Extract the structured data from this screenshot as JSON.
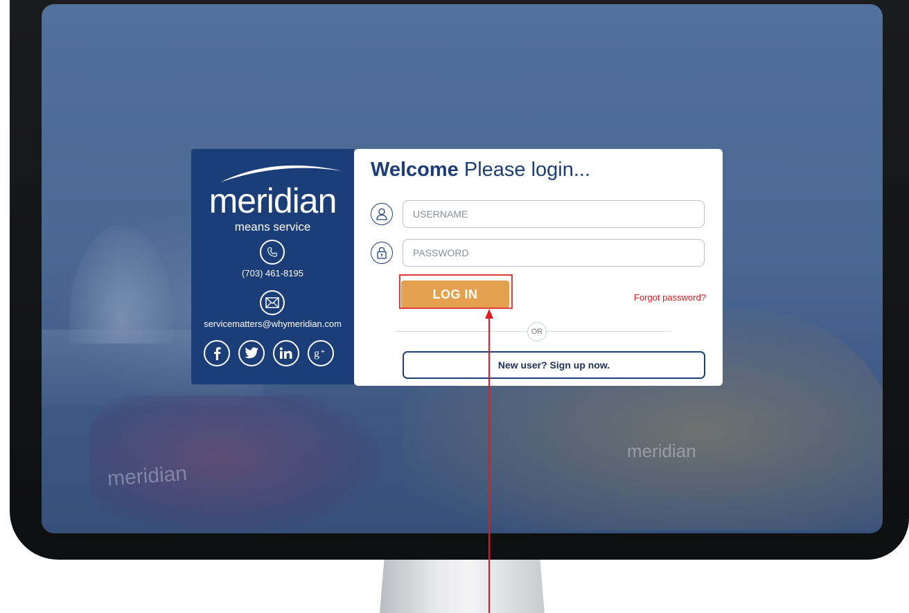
{
  "brand": {
    "name": "meridian",
    "tagline": "means service"
  },
  "contact": {
    "phone": "(703) 461-8195",
    "email": "servicematters@whymeridian.com"
  },
  "social": {
    "items": [
      "facebook-icon",
      "twitter-icon",
      "linkedin-icon",
      "google-plus-icon"
    ]
  },
  "login": {
    "welcome_bold": "Welcome",
    "welcome_rest": " Please login...",
    "username_placeholder": "USERNAME",
    "password_placeholder": "PASSWORD",
    "login_label": "LOG IN",
    "forgot_label": "Forgot password?",
    "or_label": "OR",
    "signup_label": "New user? Sign up now."
  },
  "background": {
    "car_text": "meridian",
    "van_text": "meridian"
  },
  "colors": {
    "brand_navy": "#1c3e78",
    "login_orange": "#e3a14f",
    "annotation_red": "#e01b1b"
  }
}
